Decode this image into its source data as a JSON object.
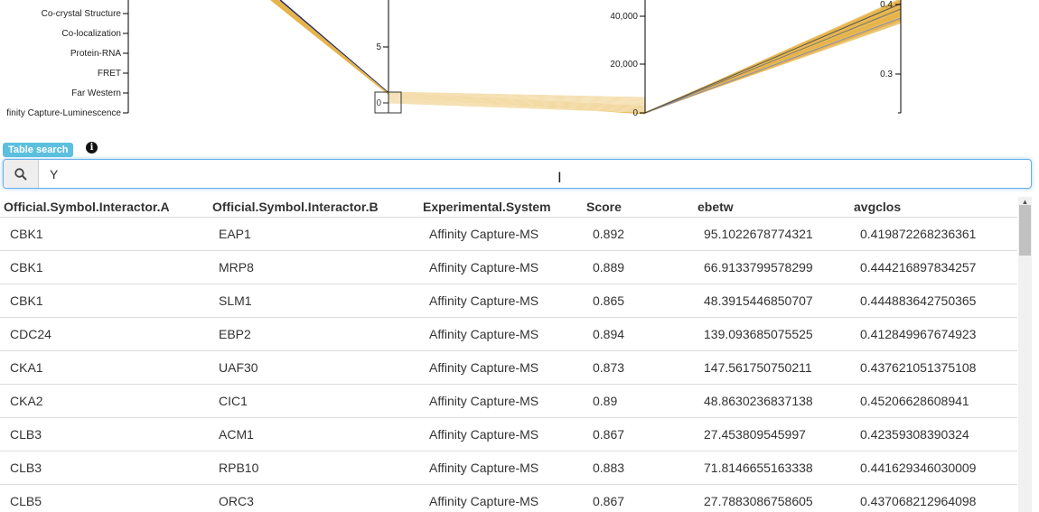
{
  "parallel_coords": {
    "axis1_labels": [
      "Co-crystal Structure",
      "Co-localization",
      "Protein-RNA",
      "FRET",
      "Far Western",
      "finity Capture-Luminescence"
    ],
    "axis2_ticks": [
      "5",
      "0"
    ],
    "axis3_ticks": [
      "40,000",
      "20,000",
      "0"
    ],
    "axis4_ticks": [
      "0.4",
      "0.3"
    ],
    "colors": {
      "highlight": "#e6b44b",
      "faded": "#f5dfb0",
      "other": "#1f2a6b",
      "grey": "#8b8fb3"
    }
  },
  "search": {
    "badge_label": "Table search",
    "info_icon": "info-icon",
    "search_icon": "search-icon",
    "value": "Y",
    "placeholder": ""
  },
  "table": {
    "columns": [
      "Official.Symbol.Interactor.A",
      "Official.Symbol.Interactor.B",
      "Experimental.System",
      "Score",
      "ebetw",
      "avgclos"
    ],
    "rows": [
      [
        "CBK1",
        "EAP1",
        "Affinity Capture-MS",
        "0.892",
        "95.1022678774321",
        "0.419872268236361"
      ],
      [
        "CBK1",
        "MRP8",
        "Affinity Capture-MS",
        "0.889",
        "66.9133799578299",
        "0.444216897834257"
      ],
      [
        "CBK1",
        "SLM1",
        "Affinity Capture-MS",
        "0.865",
        "48.3915446850707",
        "0.444883642750365"
      ],
      [
        "CDC24",
        "EBP2",
        "Affinity Capture-MS",
        "0.894",
        "139.093685075525",
        "0.412849967674923"
      ],
      [
        "CKA1",
        "UAF30",
        "Affinity Capture-MS",
        "0.873",
        "147.561750750211",
        "0.437621051375108"
      ],
      [
        "CKA2",
        "CIC1",
        "Affinity Capture-MS",
        "0.89",
        "48.8630236837138",
        "0.45206628608941"
      ],
      [
        "CLB3",
        "ACM1",
        "Affinity Capture-MS",
        "0.867",
        "27.453809545997",
        "0.42359308390324"
      ],
      [
        "CLB3",
        "RPB10",
        "Affinity Capture-MS",
        "0.883",
        "71.8146655163338",
        "0.441629346030009"
      ],
      [
        "CLB5",
        "ORC3",
        "Affinity Capture-MS",
        "0.867",
        "27.7883086758605",
        "0.437068212964098"
      ]
    ]
  }
}
